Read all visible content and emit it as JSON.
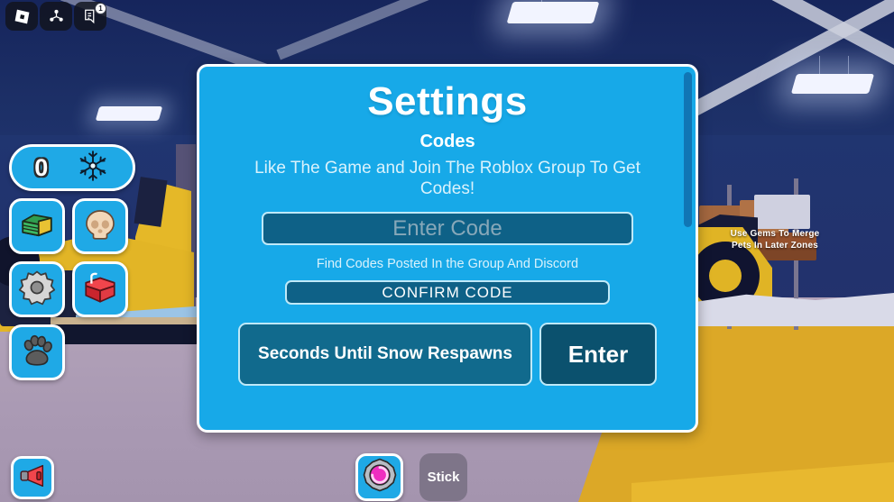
{
  "topbar": {
    "items": [
      {
        "name": "roblox-logo-icon",
        "label": "Roblox",
        "badge": null
      },
      {
        "name": "friends-icon",
        "label": "Friends",
        "badge": null
      },
      {
        "name": "chat-icon",
        "label": "Chat",
        "badge": "1"
      }
    ]
  },
  "hud": {
    "counter": {
      "value": "0",
      "icon": "snowflake-icon"
    },
    "buttons": [
      {
        "name": "money-button",
        "icon": "cash-stack-icon"
      },
      {
        "name": "skull-button",
        "icon": "skull-icon"
      },
      {
        "name": "settings-button",
        "icon": "gear-icon"
      },
      {
        "name": "inventory-button",
        "icon": "red-basket-icon"
      },
      {
        "name": "pets-button",
        "icon": "paw-print-icon"
      }
    ],
    "megaphone": {
      "name": "announce-button",
      "icon": "megaphone-icon"
    },
    "hotbar": [
      {
        "name": "portal-tool",
        "icon": "pink-spiral-icon",
        "label": ""
      },
      {
        "name": "stick-tool",
        "icon": "",
        "label": "Stick"
      }
    ]
  },
  "world": {
    "billboard_text": "Use Gems To Merge Pets In Later Zones"
  },
  "settings": {
    "title": "Settings",
    "codes_heading": "Codes",
    "codes_subtitle": "Like The Game and Join The Roblox Group To Get Codes!",
    "code_input_value": "",
    "code_input_placeholder": "Enter Code",
    "codes_note": "Find Codes Posted In the Group And Discord",
    "confirm_code_label": "CONFIRM CODE",
    "respawn_label": "Seconds Until Snow Respawns",
    "respawn_enter_label": "Enter"
  },
  "colors": {
    "panel_blue": "#17a9e8",
    "field_dark": "#0e6187",
    "field_border": "#bfe9f8",
    "enter_dark": "#0b516e",
    "hud_blue": "#1fa9e6",
    "floor_gold": "#dca827",
    "floor_gray": "#b3a3b9",
    "ceiling_navy": "#1c2f66"
  }
}
